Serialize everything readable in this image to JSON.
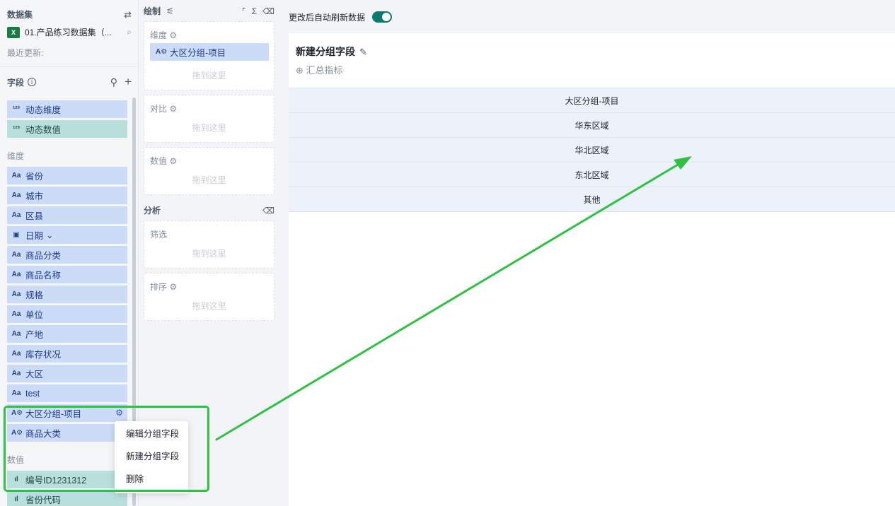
{
  "left_panel": {
    "dataset_title": "数据集",
    "dataset_name": "01.产品练习数据集（...",
    "last_update_label": "最近更新:",
    "fields_title": "字段",
    "dynamic": [
      {
        "label": "动态维度",
        "kind": "dim"
      },
      {
        "label": "动态数值",
        "kind": "val"
      }
    ],
    "dimension_group": "维度",
    "dimensions": [
      "省份",
      "城市",
      "区县",
      "日期",
      "商品分类",
      "商品名称",
      "规格",
      "单位",
      "产地",
      "库存状况",
      "大区",
      "test",
      "大区分组-项目",
      "商品大类"
    ],
    "value_group": "数值",
    "values": [
      "编号ID1231312",
      "省份代码"
    ]
  },
  "mid_panel": {
    "draw_title": "绘制",
    "dimension_well": "维度",
    "dimension_chip": "大区分组-项目",
    "compare_well": "对比",
    "value_well": "数值",
    "drop_hint": "拖到这里",
    "analysis_title": "分析",
    "filter_well": "筛选",
    "sort_well": "排序"
  },
  "canvas": {
    "auto_refresh_label": "更改后自动刷新数据",
    "auto_refresh_on": true,
    "chart_title": "新建分组字段",
    "add_metric": "汇总指标",
    "table": {
      "header": "大区分组-项目",
      "rows": [
        "华东区域",
        "华北区域",
        "东北区域",
        "其他"
      ]
    }
  },
  "context_menu": {
    "items": [
      "编辑分组字段",
      "新建分组字段",
      "删除"
    ]
  },
  "colors": {
    "dimension_bg": "#ccdcf8",
    "value_bg": "#b9dfdc",
    "toggle_on": "#0d7a70",
    "annotation_green": "#2ec143"
  }
}
